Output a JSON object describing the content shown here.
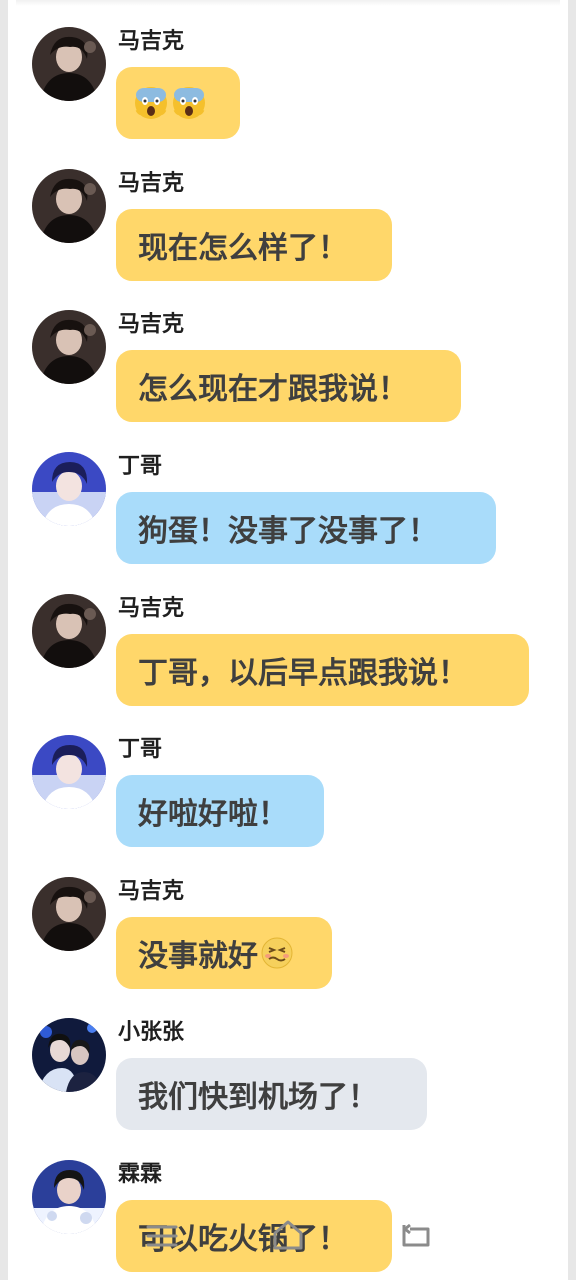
{
  "messages": [
    {
      "sender": "马吉克",
      "text": "",
      "emojis": [
        "scream-emoji",
        "scream-emoji"
      ],
      "bubble_color": "#ffd76a",
      "avatar": "magic-avatar"
    },
    {
      "sender": "马吉克",
      "text": "现在怎么样了！",
      "bubble_color": "#ffd76a",
      "avatar": "magic-avatar"
    },
    {
      "sender": "马吉克",
      "text": "怎么现在才跟我说！",
      "bubble_color": "#ffd76a",
      "avatar": "magic-avatar"
    },
    {
      "sender": "丁哥",
      "text": "狗蛋！没事了没事了！",
      "bubble_color": "#a9dcfa",
      "avatar": "ding-avatar"
    },
    {
      "sender": "马吉克",
      "text": "丁哥，以后早点跟我说！",
      "bubble_color": "#ffd76a",
      "avatar": "magic-avatar"
    },
    {
      "sender": "丁哥",
      "text": "好啦好啦！",
      "bubble_color": "#a9dcfa",
      "avatar": "ding-avatar"
    },
    {
      "sender": "马吉克",
      "text": "没事就好",
      "emoji_after": "grimace-emoji",
      "bubble_color": "#ffd76a",
      "avatar": "magic-avatar"
    },
    {
      "sender": "小张张",
      "text": "我们快到机场了！",
      "bubble_color": "#e4e8ee",
      "avatar": "xiaozhang-avatar"
    },
    {
      "sender": "霖霖",
      "text": "可以吃火锅了！",
      "bubble_color": "#ffd76a",
      "avatar": "linlin-avatar"
    }
  ],
  "navbar": {
    "icons": [
      "menu-icon",
      "home-icon",
      "back-icon"
    ]
  }
}
